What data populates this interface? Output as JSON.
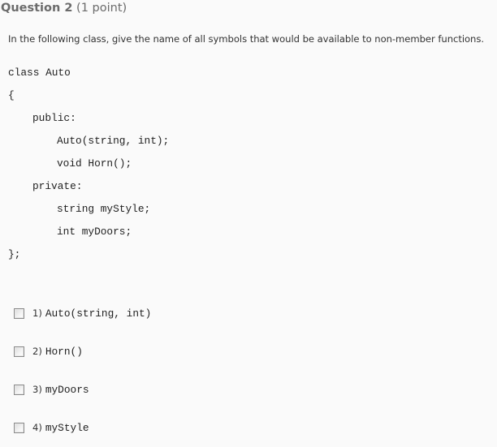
{
  "question": {
    "label": "Question 2",
    "points": "(1 point)",
    "prompt": "In the following class, give the name of all symbols that would be available to non-member functions."
  },
  "code": {
    "lines": [
      "class Auto",
      "{",
      "public:",
      "Auto(string, int);",
      "void Horn();",
      "private:",
      "string myStyle;",
      "int myDoors;",
      "};"
    ]
  },
  "options": [
    {
      "number": "1)",
      "text": "Auto(string, int)",
      "checked": false
    },
    {
      "number": "2)",
      "text": "Horn()",
      "checked": false
    },
    {
      "number": "3)",
      "text": "myDoors",
      "checked": false
    },
    {
      "number": "4)",
      "text": "myStyle",
      "checked": false
    }
  ]
}
